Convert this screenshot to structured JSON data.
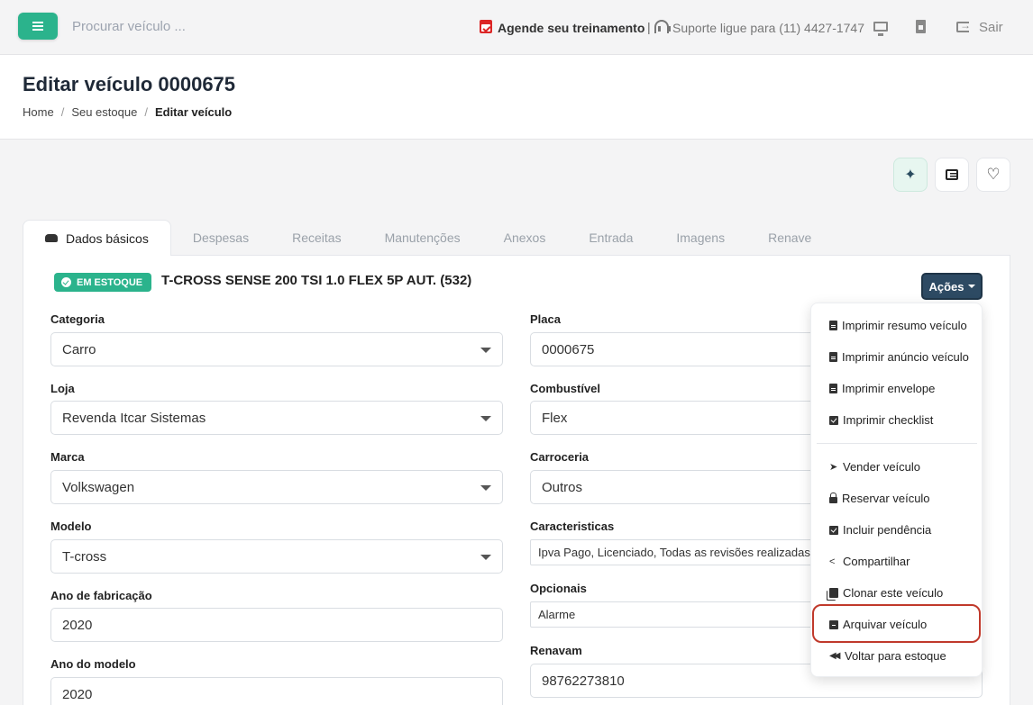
{
  "topbar": {
    "search_placeholder": "Procurar veículo ...",
    "training": "Agende seu treinamento",
    "separator": "|",
    "support": "Suporte ligue para (11) 4427-1747",
    "logout": "Sair"
  },
  "header": {
    "title": "Editar veículo 0000675",
    "breadcrumb": [
      "Home",
      "Seu estoque",
      "Editar veículo"
    ],
    "breadcrumb_sep": "/"
  },
  "tabs": [
    "Dados básicos",
    "Despesas",
    "Receitas",
    "Manutenções",
    "Anexos",
    "Entrada",
    "Imagens",
    "Renave"
  ],
  "vehicle": {
    "status": "EM ESTOQUE",
    "title": "T-CROSS SENSE 200 TSI 1.0 FLEX 5P AUT. (532)",
    "actions_label": "Ações"
  },
  "form": {
    "left": [
      {
        "label": "Categoria",
        "value": "Carro"
      },
      {
        "label": "Loja",
        "value": "Revenda Itcar Sistemas"
      },
      {
        "label": "Marca",
        "value": "Volkswagen"
      },
      {
        "label": "Modelo",
        "value": "T-cross"
      },
      {
        "label": "Ano de fabricação",
        "value": "2020"
      },
      {
        "label": "Ano do modelo",
        "value": "2020"
      }
    ],
    "right": [
      {
        "label": "Placa",
        "value": "0000675"
      },
      {
        "label": "Combustível",
        "value": "Flex"
      },
      {
        "label": "Carroceria",
        "value": "Outros"
      },
      {
        "label": "Caracteristicas",
        "value": "Ipva Pago, Licenciado, Todas as revisões realizadas"
      },
      {
        "label": "Opcionais",
        "value": "Alarme"
      },
      {
        "label": "Renavam",
        "value": "98762273810"
      }
    ]
  },
  "actions_menu": [
    {
      "label": "Imprimir resumo veículo",
      "icon": "file-icon"
    },
    {
      "label": "Imprimir anúncio veículo",
      "icon": "file-icon"
    },
    {
      "label": "Imprimir envelope",
      "icon": "file-icon"
    },
    {
      "label": "Imprimir checklist",
      "icon": "check-square-icon"
    },
    {
      "label": "Vender veículo",
      "icon": "paper-plane-icon"
    },
    {
      "label": "Reservar veículo",
      "icon": "lock-icon"
    },
    {
      "label": "Incluir pendência",
      "icon": "check-square-icon"
    },
    {
      "label": "Compartilhar",
      "icon": "share-icon"
    },
    {
      "label": "Clonar este veículo",
      "icon": "clone-icon"
    },
    {
      "label": "Arquivar veículo",
      "icon": "archive-icon"
    },
    {
      "label": "Voltar para estoque",
      "icon": "backward-icon"
    }
  ],
  "colors": {
    "brand_green": "#2bb38c",
    "actions_button": "#2d4a63",
    "highlight": "#c0392b",
    "calendar_icon": "#dc2626"
  }
}
